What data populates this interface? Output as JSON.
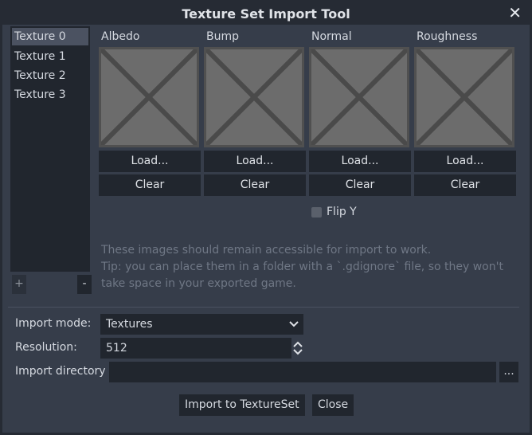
{
  "window": {
    "title": "Texture Set Import Tool",
    "close_glyph": "✕"
  },
  "texture_list": {
    "items": [
      "Texture 0",
      "Texture 1",
      "Texture 2",
      "Texture 3"
    ],
    "selected_index": 0,
    "add_label": "+",
    "remove_label": "-"
  },
  "maps": [
    {
      "label": "Albedo",
      "load": "Load...",
      "clear": "Clear"
    },
    {
      "label": "Bump",
      "load": "Load...",
      "clear": "Clear"
    },
    {
      "label": "Normal",
      "load": "Load...",
      "clear": "Clear"
    },
    {
      "label": "Roughness",
      "load": "Load...",
      "clear": "Clear"
    }
  ],
  "flip_y": {
    "label": "Flip Y",
    "checked": false
  },
  "notes": {
    "line1": "These images should remain accessible for import to work.",
    "line2": "Tip: you can place them in a folder with a `.gdignore` file, so they won't take space in your exported game."
  },
  "import_mode": {
    "label": "Import mode:",
    "value": "Textures"
  },
  "resolution": {
    "label": "Resolution:",
    "value": "512"
  },
  "import_directory": {
    "label": "Import directory",
    "value": "",
    "browse_label": "..."
  },
  "actions": {
    "import_label": "Import to TextureSet",
    "close_label": "Close"
  },
  "colors": {
    "panel": "#363d4a",
    "field": "#21262e",
    "placeholder": "#6c6c6c"
  }
}
